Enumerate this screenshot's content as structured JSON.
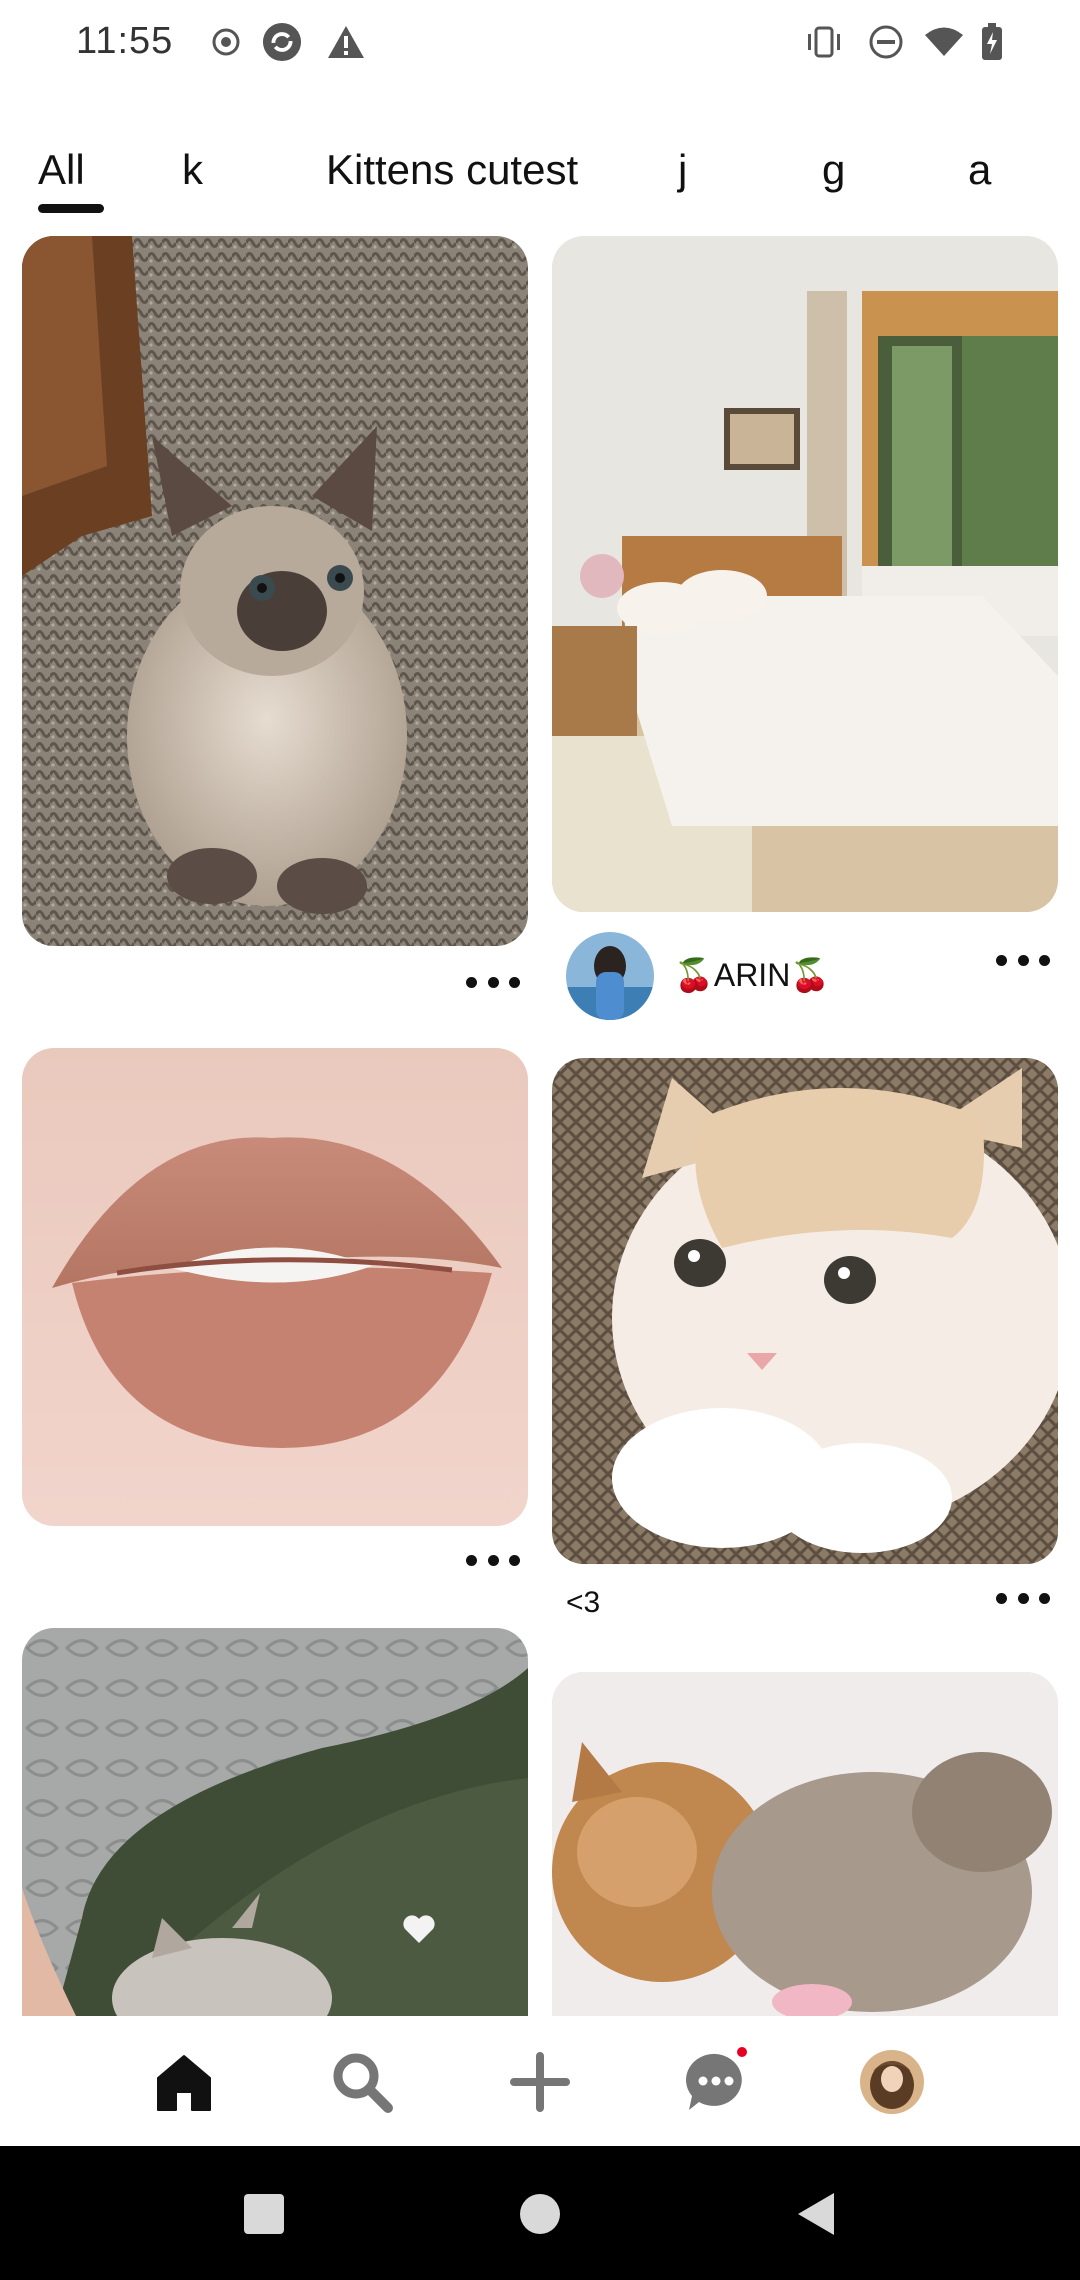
{
  "status_bar": {
    "time": "11:55",
    "left_icons": [
      "record-icon",
      "sync-app-icon",
      "warning-icon"
    ],
    "right_icons": [
      "vibrate-icon",
      "do-not-disturb-icon",
      "wifi-icon",
      "battery-charging-icon"
    ]
  },
  "tabs": [
    {
      "label": "All",
      "selected": true
    },
    {
      "label": "k",
      "selected": false
    },
    {
      "label": "Kittens cutest",
      "selected": false
    },
    {
      "label": "j",
      "selected": false
    },
    {
      "label": "g",
      "selected": false
    },
    {
      "label": "a",
      "selected": false
    }
  ],
  "feed": {
    "pins": [
      {
        "id": "pin-1",
        "image": "siamese-kitten-on-rug",
        "column": "left"
      },
      {
        "id": "pin-2",
        "image": "bright-bedroom-with-window",
        "column": "right",
        "author": "🍒ARIN🍒"
      },
      {
        "id": "pin-3",
        "image": "close-up-lips",
        "column": "left"
      },
      {
        "id": "pin-4",
        "image": "fluffy-cream-kitten",
        "column": "right",
        "caption": "<3"
      },
      {
        "id": "pin-5",
        "image": "kitten-on-green-couch",
        "column": "left"
      },
      {
        "id": "pin-6",
        "image": "two-kittens-on-blanket",
        "column": "right"
      }
    ]
  },
  "bottom_nav": {
    "items": [
      "home-icon",
      "search-icon",
      "create-icon",
      "messages-icon",
      "profile-avatar"
    ],
    "active": "home-icon",
    "messages_has_notification": true
  },
  "system_nav": [
    "recents-button",
    "home-button",
    "back-button"
  ],
  "colors": {
    "accent": "#e60023",
    "text": "#111111",
    "background": "#ffffff"
  }
}
